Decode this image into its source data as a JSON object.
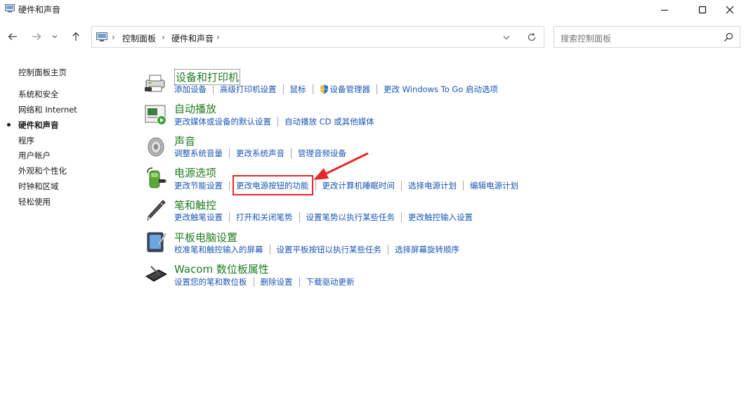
{
  "window": {
    "title": "硬件和声音"
  },
  "breadcrumb": {
    "items": [
      "控制面板",
      "硬件和声音"
    ]
  },
  "search": {
    "placeholder": "搜索控制面板"
  },
  "sidebar": {
    "home": "控制面板主页",
    "items": [
      {
        "label": "系统和安全",
        "active": false
      },
      {
        "label": "网络和 Internet",
        "active": false
      },
      {
        "label": "硬件和声音",
        "active": true
      },
      {
        "label": "程序",
        "active": false
      },
      {
        "label": "用户帐户",
        "active": false
      },
      {
        "label": "外观和个性化",
        "active": false
      },
      {
        "label": "时钟和区域",
        "active": false
      },
      {
        "label": "轻松使用",
        "active": false
      }
    ]
  },
  "categories": [
    {
      "title": "设备和打印机",
      "icon": "printer-icon",
      "links": [
        "添加设备",
        "高级打印机设置",
        "鼠标",
        "设备管理器",
        "更改 Windows To Go 启动选项"
      ]
    },
    {
      "title": "自动播放",
      "icon": "autoplay-icon",
      "links": [
        "更改媒体或设备的默认设置",
        "自动播放 CD 或其他媒体"
      ]
    },
    {
      "title": "声音",
      "icon": "speaker-icon",
      "links": [
        "调整系统音量",
        "更改系统声音",
        "管理音频设备"
      ]
    },
    {
      "title": "电源选项",
      "icon": "power-options-icon",
      "links": [
        "更改节能设置",
        "更改电源按钮的功能",
        "更改计算机睡眠时间",
        "选择电源计划",
        "编辑电源计划"
      ]
    },
    {
      "title": "笔和触控",
      "icon": "pen-icon",
      "links": [
        "更改触笔设置",
        "打开和关闭笔势",
        "设置笔势以执行某些任务",
        "更改触控输入设置"
      ]
    },
    {
      "title": "平板电脑设置",
      "icon": "tablet-icon",
      "links": [
        "校准笔和触控输入的屏幕",
        "设置平板按钮以执行某些任务",
        "选择屏幕旋转顺序"
      ]
    },
    {
      "title": "Wacom 数位板属性",
      "icon": "wacom-tablet-icon",
      "links": [
        "设置您的笔和数位板",
        "删除设置",
        "下载驱动更新"
      ]
    }
  ],
  "colors": {
    "category_title": "#1e7d1e",
    "link": "#1a57b3",
    "highlight": "#e8262b"
  }
}
